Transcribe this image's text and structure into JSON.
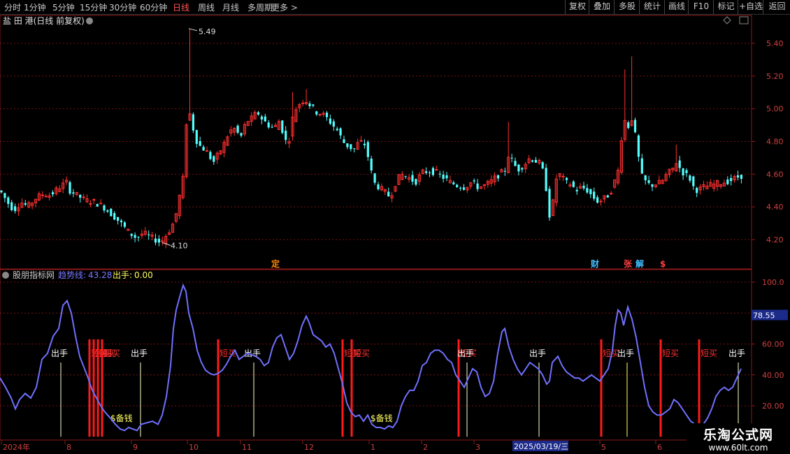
{
  "toolbar": {
    "periods": [
      "分时",
      "1分钟",
      "5分钟",
      "15分钟",
      "30分钟",
      "60分钟",
      "日线",
      "周线",
      "月线",
      "多周期",
      "更多 >"
    ],
    "active_period": "日线",
    "actions": [
      "复权",
      "叠加",
      "多股",
      "统计",
      "画线",
      "F10",
      "标记",
      "+自选",
      "返回"
    ]
  },
  "stock_title": "盐 田 港(日线 前复权)",
  "indicator_header": {
    "name": "股朋指标网",
    "trend_label": "趋势线:",
    "trend_value": "43.28",
    "out_label": "出手:",
    "out_value": "0.00"
  },
  "price_axis_labels": [
    "5.40",
    "5.20",
    "5.00",
    "4.80",
    "4.60",
    "4.40",
    "4.20"
  ],
  "indicator_axis_labels": [
    "100.0",
    "80.00",
    "60.00",
    "40.00",
    "20.00"
  ],
  "indicator_current_value": "78.55",
  "high_annotation": "5.49",
  "low_annotation": "4.10",
  "event_markers": [
    {
      "text": "定",
      "color": "#ff8800"
    },
    {
      "text": "财",
      "color": "#40c0ff"
    },
    {
      "text": "张",
      "color": "#ff4040"
    },
    {
      "text": "解",
      "color": "#40c0ff"
    },
    {
      "text": "$",
      "color": "#ff4040"
    }
  ],
  "signal_labels": {
    "out": "出手",
    "buy": "短买",
    "money": "$备钱"
  },
  "time_axis": {
    "labels": [
      "2024年",
      "8",
      "9",
      "10",
      "11",
      "12",
      "1",
      "2",
      "3",
      "4",
      "5",
      "6"
    ],
    "cursor_date": "2025/03/19/三"
  },
  "watermark": {
    "title": "乐淘公式网",
    "url": "www.60lt.com"
  },
  "chart_data": {
    "type": "candlestick",
    "title": "盐 田 港(日线 前复权)",
    "ylim": [
      4.1,
      5.55
    ],
    "price_path": [
      [
        0,
        4.5
      ],
      [
        6,
        4.46
      ],
      [
        12,
        4.42
      ],
      [
        20,
        4.38
      ],
      [
        30,
        4.43
      ],
      [
        40,
        4.4
      ],
      [
        50,
        4.45
      ],
      [
        62,
        4.48
      ],
      [
        72,
        4.47
      ],
      [
        85,
        4.52
      ],
      [
        95,
        4.55
      ],
      [
        100,
        4.5
      ],
      [
        110,
        4.47
      ],
      [
        122,
        4.44
      ],
      [
        135,
        4.43
      ],
      [
        148,
        4.4
      ],
      [
        158,
        4.36
      ],
      [
        166,
        4.33
      ],
      [
        175,
        4.29
      ],
      [
        185,
        4.24
      ],
      [
        195,
        4.21
      ],
      [
        205,
        4.24
      ],
      [
        212,
        4.22
      ],
      [
        222,
        4.2
      ],
      [
        230,
        4.18
      ],
      [
        238,
        4.23
      ],
      [
        246,
        4.28
      ],
      [
        252,
        4.36
      ],
      [
        258,
        4.49
      ],
      [
        263,
        4.6
      ],
      [
        266,
        4.88
      ],
      [
        269,
        5.05
      ],
      [
        272,
        4.95
      ],
      [
        278,
        4.85
      ],
      [
        283,
        4.78
      ],
      [
        290,
        4.76
      ],
      [
        297,
        4.73
      ],
      [
        305,
        4.67
      ],
      [
        312,
        4.72
      ],
      [
        320,
        4.78
      ],
      [
        328,
        4.86
      ],
      [
        336,
        4.88
      ],
      [
        344,
        4.82
      ],
      [
        352,
        4.92
      ],
      [
        360,
        4.94
      ],
      [
        368,
        4.98
      ],
      [
        376,
        4.93
      ],
      [
        384,
        4.9
      ],
      [
        392,
        4.88
      ],
      [
        400,
        4.93
      ],
      [
        408,
        4.8
      ],
      [
        414,
        4.82
      ],
      [
        420,
        4.98
      ],
      [
        428,
        5.03
      ],
      [
        436,
        5.06
      ],
      [
        444,
        5.02
      ],
      [
        452,
        4.98
      ],
      [
        460,
        4.97
      ],
      [
        468,
        4.94
      ],
      [
        476,
        4.9
      ],
      [
        484,
        4.86
      ],
      [
        490,
        4.8
      ],
      [
        498,
        4.77
      ],
      [
        506,
        4.75
      ],
      [
        514,
        4.8
      ],
      [
        522,
        4.78
      ],
      [
        528,
        4.68
      ],
      [
        534,
        4.55
      ],
      [
        542,
        4.52
      ],
      [
        550,
        4.49
      ],
      [
        558,
        4.46
      ],
      [
        566,
        4.55
      ],
      [
        574,
        4.6
      ],
      [
        584,
        4.58
      ],
      [
        594,
        4.55
      ],
      [
        604,
        4.61
      ],
      [
        614,
        4.62
      ],
      [
        624,
        4.61
      ],
      [
        634,
        4.58
      ],
      [
        644,
        4.55
      ],
      [
        654,
        4.53
      ],
      [
        664,
        4.52
      ],
      [
        674,
        4.55
      ],
      [
        684,
        4.52
      ],
      [
        694,
        4.53
      ],
      [
        704,
        4.56
      ],
      [
        714,
        4.6
      ],
      [
        722,
        4.62
      ],
      [
        728,
        4.73
      ],
      [
        734,
        4.66
      ],
      [
        742,
        4.63
      ],
      [
        750,
        4.66
      ],
      [
        758,
        4.7
      ],
      [
        766,
        4.68
      ],
      [
        774,
        4.66
      ],
      [
        780,
        4.55
      ],
      [
        786,
        4.35
      ],
      [
        790,
        4.4
      ],
      [
        796,
        4.58
      ],
      [
        802,
        4.6
      ],
      [
        808,
        4.55
      ],
      [
        816,
        4.54
      ],
      [
        824,
        4.5
      ],
      [
        832,
        4.52
      ],
      [
        840,
        4.5
      ],
      [
        848,
        4.46
      ],
      [
        856,
        4.43
      ],
      [
        864,
        4.45
      ],
      [
        872,
        4.48
      ],
      [
        878,
        4.54
      ],
      [
        884,
        4.62
      ],
      [
        888,
        4.8
      ],
      [
        892,
        4.9
      ],
      [
        896,
        4.96
      ],
      [
        900,
        4.86
      ],
      [
        904,
        4.95
      ],
      [
        908,
        4.85
      ],
      [
        912,
        4.75
      ],
      [
        916,
        4.6
      ],
      [
        922,
        4.56
      ],
      [
        930,
        4.53
      ],
      [
        938,
        4.54
      ],
      [
        946,
        4.55
      ],
      [
        954,
        4.6
      ],
      [
        962,
        4.63
      ],
      [
        968,
        4.68
      ],
      [
        974,
        4.62
      ],
      [
        980,
        4.6
      ],
      [
        986,
        4.58
      ],
      [
        992,
        4.52
      ],
      [
        998,
        4.5
      ],
      [
        1006,
        4.52
      ],
      [
        1014,
        4.53
      ],
      [
        1024,
        4.54
      ],
      [
        1034,
        4.55
      ],
      [
        1044,
        4.56
      ],
      [
        1054,
        4.58
      ],
      [
        1060,
        4.59
      ]
    ],
    "spikes": [
      [
        268,
        5.49
      ],
      [
        416,
        5.1
      ],
      [
        438,
        5.12
      ],
      [
        726,
        4.92
      ],
      [
        890,
        5.24
      ],
      [
        902,
        5.32
      ],
      [
        966,
        4.78
      ]
    ],
    "trend_series": {
      "name": "趋势线",
      "points": [
        [
          0,
          38
        ],
        [
          8,
          32
        ],
        [
          16,
          25
        ],
        [
          22,
          18
        ],
        [
          28,
          24
        ],
        [
          36,
          28
        ],
        [
          44,
          25
        ],
        [
          52,
          32
        ],
        [
          60,
          50
        ],
        [
          68,
          54
        ],
        [
          76,
          65
        ],
        [
          84,
          70
        ],
        [
          90,
          85
        ],
        [
          96,
          88
        ],
        [
          102,
          80
        ],
        [
          108,
          65
        ],
        [
          114,
          52
        ],
        [
          120,
          45
        ],
        [
          126,
          38
        ],
        [
          132,
          30
        ],
        [
          138,
          25
        ],
        [
          144,
          20
        ],
        [
          150,
          16
        ],
        [
          158,
          12
        ],
        [
          165,
          8
        ],
        [
          172,
          5
        ],
        [
          178,
          4
        ],
        [
          184,
          6
        ],
        [
          190,
          5
        ],
        [
          196,
          4
        ],
        [
          202,
          8
        ],
        [
          210,
          9
        ],
        [
          218,
          10
        ],
        [
          226,
          8
        ],
        [
          232,
          14
        ],
        [
          238,
          26
        ],
        [
          244,
          46
        ],
        [
          248,
          70
        ],
        [
          252,
          82
        ],
        [
          258,
          92
        ],
        [
          262,
          98
        ],
        [
          266,
          94
        ],
        [
          270,
          80
        ],
        [
          276,
          70
        ],
        [
          282,
          56
        ],
        [
          288,
          48
        ],
        [
          294,
          43
        ],
        [
          300,
          41
        ],
        [
          306,
          40
        ],
        [
          312,
          41
        ],
        [
          318,
          43
        ],
        [
          324,
          47
        ],
        [
          330,
          52
        ],
        [
          336,
          56
        ],
        [
          342,
          50
        ],
        [
          348,
          52
        ],
        [
          354,
          54
        ],
        [
          360,
          53
        ],
        [
          366,
          52
        ],
        [
          372,
          50
        ],
        [
          378,
          46
        ],
        [
          384,
          48
        ],
        [
          390,
          58
        ],
        [
          396,
          64
        ],
        [
          402,
          66
        ],
        [
          408,
          58
        ],
        [
          414,
          50
        ],
        [
          420,
          54
        ],
        [
          426,
          62
        ],
        [
          432,
          72
        ],
        [
          438,
          78
        ],
        [
          442,
          74
        ],
        [
          448,
          66
        ],
        [
          454,
          64
        ],
        [
          460,
          62
        ],
        [
          466,
          58
        ],
        [
          472,
          60
        ],
        [
          478,
          54
        ],
        [
          484,
          44
        ],
        [
          490,
          34
        ],
        [
          496,
          22
        ],
        [
          502,
          16
        ],
        [
          508,
          13
        ],
        [
          514,
          14
        ],
        [
          520,
          10
        ],
        [
          526,
          14
        ],
        [
          532,
          8
        ],
        [
          538,
          6
        ],
        [
          544,
          6
        ],
        [
          550,
          5
        ],
        [
          556,
          7
        ],
        [
          562,
          6
        ],
        [
          568,
          10
        ],
        [
          574,
          20
        ],
        [
          580,
          26
        ],
        [
          586,
          30
        ],
        [
          592,
          30
        ],
        [
          598,
          36
        ],
        [
          604,
          46
        ],
        [
          610,
          48
        ],
        [
          616,
          54
        ],
        [
          622,
          56
        ],
        [
          628,
          56
        ],
        [
          634,
          54
        ],
        [
          640,
          50
        ],
        [
          646,
          48
        ],
        [
          652,
          40
        ],
        [
          658,
          36
        ],
        [
          664,
          32
        ],
        [
          670,
          38
        ],
        [
          676,
          44
        ],
        [
          682,
          42
        ],
        [
          688,
          32
        ],
        [
          694,
          26
        ],
        [
          700,
          28
        ],
        [
          706,
          36
        ],
        [
          712,
          54
        ],
        [
          718,
          68
        ],
        [
          722,
          70
        ],
        [
          728,
          58
        ],
        [
          734,
          50
        ],
        [
          740,
          44
        ],
        [
          746,
          40
        ],
        [
          752,
          44
        ],
        [
          758,
          48
        ],
        [
          764,
          46
        ],
        [
          770,
          44
        ],
        [
          776,
          40
        ],
        [
          782,
          34
        ],
        [
          786,
          36
        ],
        [
          790,
          48
        ],
        [
          794,
          50
        ],
        [
          798,
          52
        ],
        [
          804,
          46
        ],
        [
          810,
          42
        ],
        [
          816,
          40
        ],
        [
          822,
          38
        ],
        [
          828,
          38
        ],
        [
          834,
          36
        ],
        [
          840,
          38
        ],
        [
          846,
          40
        ],
        [
          852,
          38
        ],
        [
          858,
          36
        ],
        [
          864,
          40
        ],
        [
          870,
          44
        ],
        [
          876,
          56
        ],
        [
          880,
          72
        ],
        [
          884,
          82
        ],
        [
          888,
          80
        ],
        [
          892,
          72
        ],
        [
          898,
          84
        ],
        [
          904,
          76
        ],
        [
          910,
          64
        ],
        [
          916,
          48
        ],
        [
          922,
          32
        ],
        [
          928,
          20
        ],
        [
          934,
          16
        ],
        [
          940,
          14
        ],
        [
          946,
          14
        ],
        [
          952,
          16
        ],
        [
          958,
          18
        ],
        [
          964,
          24
        ],
        [
          970,
          22
        ],
        [
          976,
          18
        ],
        [
          982,
          14
        ],
        [
          988,
          10
        ],
        [
          994,
          8
        ],
        [
          1000,
          6
        ],
        [
          1006,
          8
        ],
        [
          1012,
          12
        ],
        [
          1018,
          18
        ],
        [
          1024,
          26
        ],
        [
          1030,
          30
        ],
        [
          1036,
          32
        ],
        [
          1042,
          30
        ],
        [
          1048,
          32
        ],
        [
          1054,
          38
        ],
        [
          1060,
          44
        ]
      ]
    },
    "out_signals": [
      87,
      201,
      363,
      668,
      771,
      897,
      1056
    ],
    "buy_signals": [
      128,
      134,
      140,
      146,
      312,
      490,
      503,
      656,
      860,
      945,
      1000
    ],
    "money_signals": [
      158,
      530
    ],
    "indicator_ylim": [
      0,
      100
    ]
  }
}
